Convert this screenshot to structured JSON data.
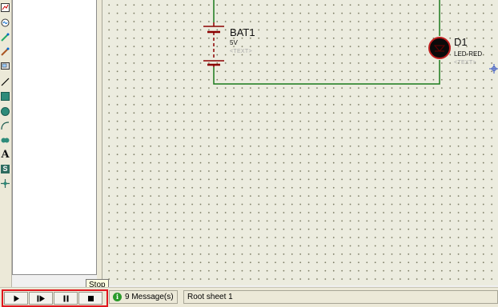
{
  "toolbar": {
    "tools": [
      {
        "icon": "graph-icon"
      },
      {
        "icon": "generator-icon"
      },
      {
        "icon": "voltage-probe-icon"
      },
      {
        "icon": "current-probe-icon"
      },
      {
        "icon": "virtual-instrument-icon"
      },
      {
        "icon": "line-icon"
      },
      {
        "icon": "box-icon"
      },
      {
        "icon": "circle-icon"
      },
      {
        "icon": "arc-icon"
      },
      {
        "icon": "path-icon"
      },
      {
        "icon": "text-icon",
        "glyph": "A"
      },
      {
        "icon": "symbol-icon",
        "glyph": "S"
      },
      {
        "icon": "marker-icon"
      }
    ]
  },
  "schematic": {
    "battery": {
      "ref": "BAT1",
      "value": "5V",
      "text": "<TEXT>"
    },
    "led": {
      "ref": "D1",
      "value": "LED-RED",
      "text": "<TEXT>"
    },
    "colors": {
      "wire": "#1a7a1a",
      "component": "#8b0000",
      "led_body": "#000000",
      "led_ring": "#c02020"
    }
  },
  "status_bar": {
    "tooltip": "Stop",
    "buttons": [
      {
        "name": "play-button",
        "icon": "play-icon"
      },
      {
        "name": "step-button",
        "icon": "step-icon"
      },
      {
        "name": "pause-button",
        "icon": "pause-icon"
      },
      {
        "name": "stop-button",
        "icon": "stop-icon"
      }
    ],
    "messages": "9 Message(s)",
    "sheet": "Root sheet 1",
    "highlight_color": "#e0161e"
  }
}
